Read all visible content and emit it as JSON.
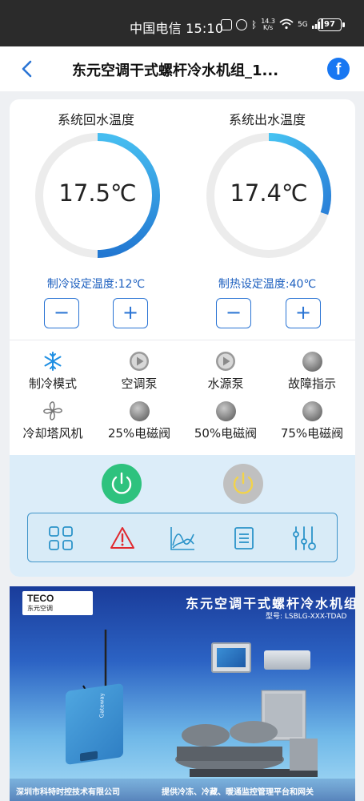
{
  "status_bar": {
    "carrier_time": "中国电信 15:10",
    "net_speed_top": "14.3",
    "net_speed_bottom": "K/s",
    "signal": "5G",
    "battery": "97"
  },
  "header": {
    "title": "东元空调干式螺杆冷水机组_1...",
    "fb_letter": "f"
  },
  "gauges": [
    {
      "label": "系统回水温度",
      "value": "17.5℃",
      "fill_fraction": 0.5,
      "setpoint": "制冷设定温度:12℃"
    },
    {
      "label": "系统出水温度",
      "value": "17.4℃",
      "fill_fraction": 0.3,
      "setpoint": "制热设定温度:40℃"
    }
  ],
  "stepper": {
    "minus": "−",
    "plus": "+"
  },
  "status_items": [
    {
      "label": "制冷模式",
      "icon": "snowflake-icon"
    },
    {
      "label": "空调泵",
      "icon": "play-icon"
    },
    {
      "label": "水源泵",
      "icon": "play-icon"
    },
    {
      "label": "故障指示",
      "icon": "indicator-light-icon"
    },
    {
      "label": "冷却塔风机",
      "icon": "fan-icon"
    },
    {
      "label": "25%电磁阀",
      "icon": "indicator-light-icon"
    },
    {
      "label": "50%电磁阀",
      "icon": "indicator-light-icon"
    },
    {
      "label": "75%电磁阀",
      "icon": "indicator-light-icon"
    }
  ],
  "toolbar": [
    "grid-icon",
    "alarm-warning-icon",
    "trend-chart-icon",
    "list-icon",
    "settings-sliders-icon"
  ],
  "colors": {
    "accent_blue": "#2a74d4",
    "power_on": "#2ec27e",
    "power_off": "#c0c0c0",
    "power_off_symbol": "#f2d34a",
    "alarm_red": "#e0292f"
  },
  "banner": {
    "logo_brand": "TECO",
    "logo_sub": "东元空调",
    "title": "东元空调干式螺杆冷水机组",
    "model": "型号: LSBLG-XXX-TDAD",
    "device_label": "Gateway",
    "footer_left": "深圳市科特时控技术有限公司",
    "footer_right": "提供冷冻、冷藏、暖通监控管理平台和网关"
  }
}
